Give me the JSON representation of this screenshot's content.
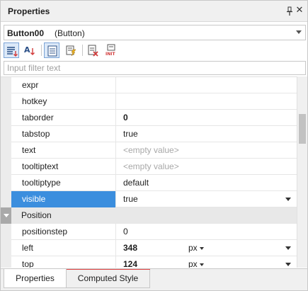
{
  "panel": {
    "title": "Properties"
  },
  "object_selector": {
    "name": "Button00",
    "type": "(Button)"
  },
  "filter": {
    "placeholder": "Input filter text",
    "value": ""
  },
  "rows": [
    {
      "name": "expr",
      "value": ""
    },
    {
      "name": "hotkey",
      "value": ""
    },
    {
      "name": "taborder",
      "value": "0"
    },
    {
      "name": "tabstop",
      "value": "true"
    },
    {
      "name": "text",
      "value": "<empty value>"
    },
    {
      "name": "tooltiptext",
      "value": "<empty value>"
    },
    {
      "name": "tooltiptype",
      "value": "default"
    },
    {
      "name": "visible",
      "value": "true"
    }
  ],
  "group": {
    "name": "Position"
  },
  "position_rows": [
    {
      "name": "positionstep",
      "value": "0"
    },
    {
      "name": "left",
      "value": "348",
      "unit": "px"
    },
    {
      "name": "top",
      "value": "124",
      "unit": "px"
    }
  ],
  "tabs": [
    {
      "label": "Properties"
    },
    {
      "label": "Computed Style"
    }
  ],
  "icons": {
    "pin": "pin-icon",
    "close": "close-icon",
    "toolbar": [
      "categorize-icon",
      "sort-alpha-icon",
      "property-view-icon",
      "event-view-icon",
      "remove-property-icon",
      "init-icon"
    ]
  },
  "colors": {
    "selected": "#3b8ede",
    "group_header": "#e8e8e8",
    "tab_accent": "#e04646"
  }
}
